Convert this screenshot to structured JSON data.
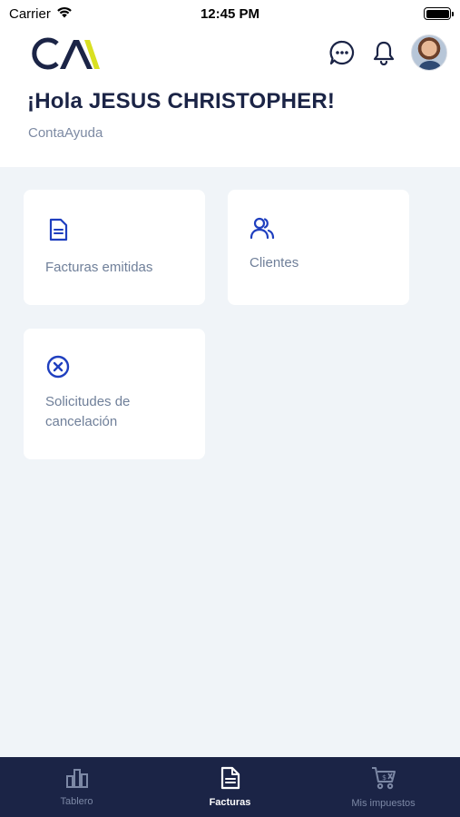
{
  "status_bar": {
    "carrier": "Carrier",
    "time": "12:45 PM"
  },
  "header": {
    "greeting": "¡Hola JESUS CHRISTOPHER!",
    "company": "ContaAyuda",
    "icons": [
      "logo-ca",
      "chat-icon",
      "bell-icon",
      "avatar"
    ]
  },
  "cards": [
    {
      "label": "Facturas emitidas",
      "icon": "document-icon"
    },
    {
      "label": "Clientes",
      "icon": "users-icon"
    },
    {
      "label": "Solicitudes de cancelación",
      "icon": "cancel-circle-icon"
    }
  ],
  "tabbar": {
    "items": [
      {
        "label": "Tablero",
        "icon": "bar-chart-icon",
        "active": false
      },
      {
        "label": "Facturas",
        "icon": "document-icon",
        "active": true
      },
      {
        "label": "Mis impuestos",
        "icon": "tax-cart-icon",
        "active": false
      }
    ]
  },
  "colors": {
    "primary": "#1b2446",
    "accent_blue": "#1f3fbf",
    "logo_yellow": "#d9e021",
    "background": "#f0f4f8",
    "muted_text": "#6f7f99"
  }
}
